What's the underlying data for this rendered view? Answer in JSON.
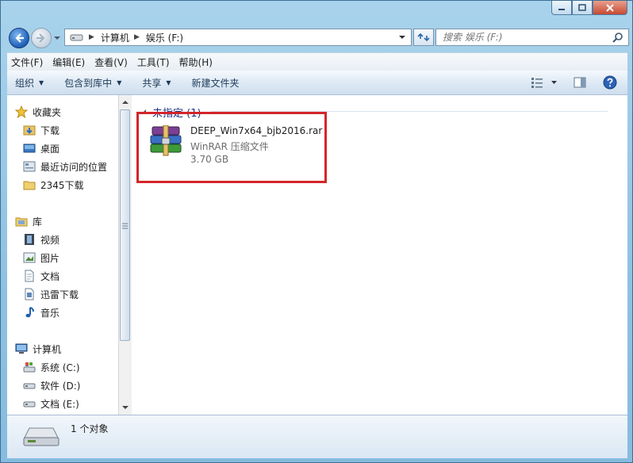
{
  "address": {
    "crumbs": [
      "计算机",
      "娱乐 (F:)"
    ]
  },
  "search": {
    "placeholder": "搜索 娱乐 (F:)"
  },
  "menu": [
    "文件(F)",
    "编辑(E)",
    "查看(V)",
    "工具(T)",
    "帮助(H)"
  ],
  "commands": {
    "organize": "组织",
    "include": "包含到库中",
    "share": "共享",
    "new_folder": "新建文件夹"
  },
  "nav": {
    "favorites": {
      "label": "收藏夹",
      "items": [
        "下载",
        "桌面",
        "最近访问的位置",
        "2345下载"
      ]
    },
    "libraries": {
      "label": "库",
      "items": [
        "视频",
        "图片",
        "文档",
        "迅雷下载",
        "音乐"
      ]
    },
    "computer": {
      "label": "计算机",
      "items": [
        "系统 (C:)",
        "软件 (D:)",
        "文档 (E:)"
      ]
    }
  },
  "group": {
    "label": "未指定 (1)"
  },
  "file": {
    "name": "DEEP_Win7x64_bjb2016.rar",
    "type": "WinRAR 压缩文件",
    "size": "3.70 GB"
  },
  "status": {
    "text": "1 个对象"
  },
  "colors": {
    "highlight": "#d4252b",
    "group_header": "#1e3287"
  }
}
